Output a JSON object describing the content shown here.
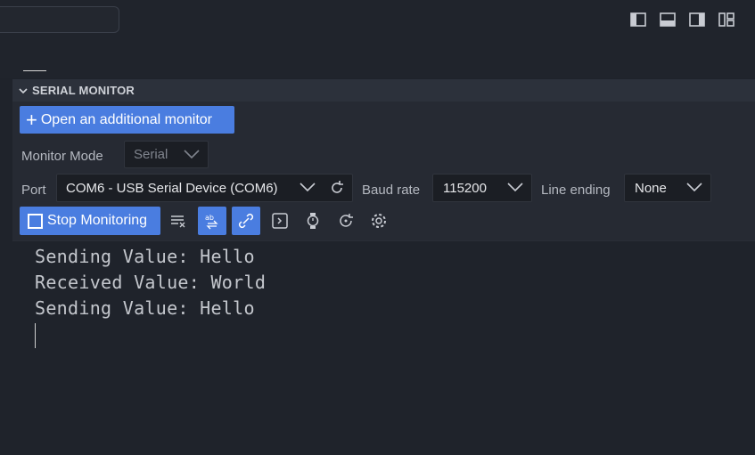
{
  "panel": {
    "title": "SERIAL MONITOR"
  },
  "toolbar": {
    "open_monitor_label": "Open an additional monitor",
    "monitor_mode_label": "Monitor Mode",
    "monitor_mode_value": "Serial",
    "port_label": "Port",
    "port_value": "COM6 - USB Serial Device (COM6)",
    "baud_label": "Baud rate",
    "baud_value": "115200",
    "line_ending_label": "Line ending",
    "line_ending_value": "None",
    "stop_label": "Stop Monitoring"
  },
  "output": {
    "lines": [
      "Sending Value: Hello",
      "Received Value: World",
      "Sending Value: Hello"
    ]
  },
  "colors": {
    "accent": "#4a7de0",
    "background": "#1f232b",
    "panel_header": "#2c313b"
  }
}
